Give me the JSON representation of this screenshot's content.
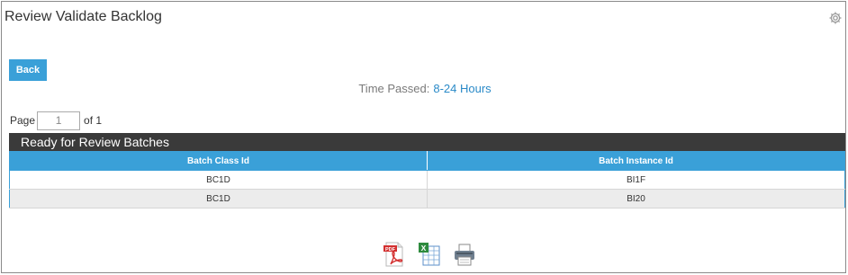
{
  "page": {
    "title": "Review Validate Backlog",
    "back_label": "Back",
    "time_passed_label": "Time Passed:",
    "time_passed_value": "8-24 Hours"
  },
  "pager": {
    "page_label": "Page",
    "current_page": "1",
    "of_label": "of 1"
  },
  "grid": {
    "caption": "Ready for Review Batches",
    "columns": [
      "Batch Class Id",
      "Batch Instance Id"
    ],
    "rows": [
      [
        "BC1D",
        "BI1F"
      ],
      [
        "BC1D",
        "BI20"
      ]
    ]
  },
  "icons": {
    "settings": "gear-icon",
    "export_pdf": "pdf-export-icon",
    "export_excel": "excel-export-icon",
    "print": "print-icon"
  },
  "colors": {
    "accent": "#3aa0d8",
    "caption_bg": "#3a3a3a",
    "link": "#2a8ac8",
    "alt_row": "#ececec"
  }
}
